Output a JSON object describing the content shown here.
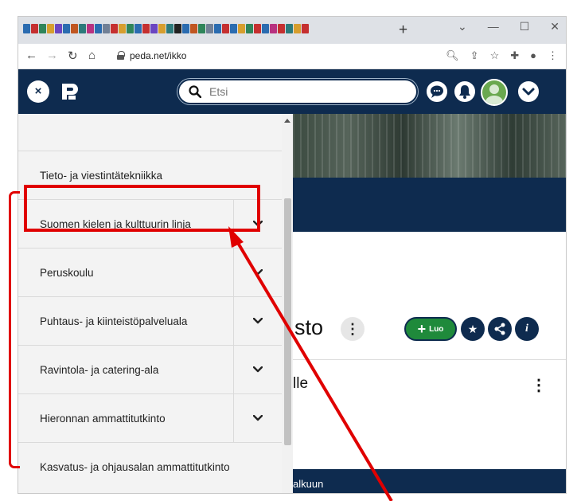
{
  "browser": {
    "new_tab": "+",
    "url": "peda.net/ikko",
    "favicon_colors": [
      "#2b6cb0",
      "#c53030",
      "#2f855a",
      "#d69e2e",
      "#6b46c1",
      "#2b6cb0",
      "#c05621",
      "#2c7a7b",
      "#b83280",
      "#2b6cb0",
      "#718096",
      "#c53030",
      "#d69e2e",
      "#2f855a",
      "#2b6cb0",
      "#c53030",
      "#6b46c1",
      "#d69e2e",
      "#2c7a7b",
      "#222222",
      "#2b6cb0",
      "#c05621",
      "#2f855a",
      "#718096",
      "#2b6cb0",
      "#c53030",
      "#2b6cb0",
      "#d69e2e",
      "#2f855a",
      "#c53030",
      "#2b6cb0",
      "#b83280",
      "#c53030",
      "#2c7a7b",
      "#d69e2e",
      "#c53030"
    ]
  },
  "header": {
    "close_glyph": "×",
    "search_placeholder": "Etsi"
  },
  "menu": {
    "items": [
      {
        "label": "Tieto- ja viestintätekniikka",
        "expandable": false
      },
      {
        "label": "Suomen kielen ja kulttuurin linja",
        "expandable": true
      },
      {
        "label": "Peruskoulu",
        "expandable": true
      },
      {
        "label": "Puhtaus- ja kiinteistöpalveluala",
        "expandable": true
      },
      {
        "label": "Ravintola- ja catering-ala",
        "expandable": true
      },
      {
        "label": "Hieronnan ammattitutkinto",
        "expandable": true
      },
      {
        "label": "Kasvatus- ja ohjausalan ammattitutkinto",
        "expandable": false
      }
    ]
  },
  "page": {
    "title_fragment": "sto",
    "luo_label": "Luo",
    "sub_fragment": "lle",
    "bottom_fragment": "alkuun"
  },
  "colors": {
    "brand_navy": "#0e2b4f",
    "create_green": "#1f8a3b",
    "annotation_red": "#e00000"
  }
}
